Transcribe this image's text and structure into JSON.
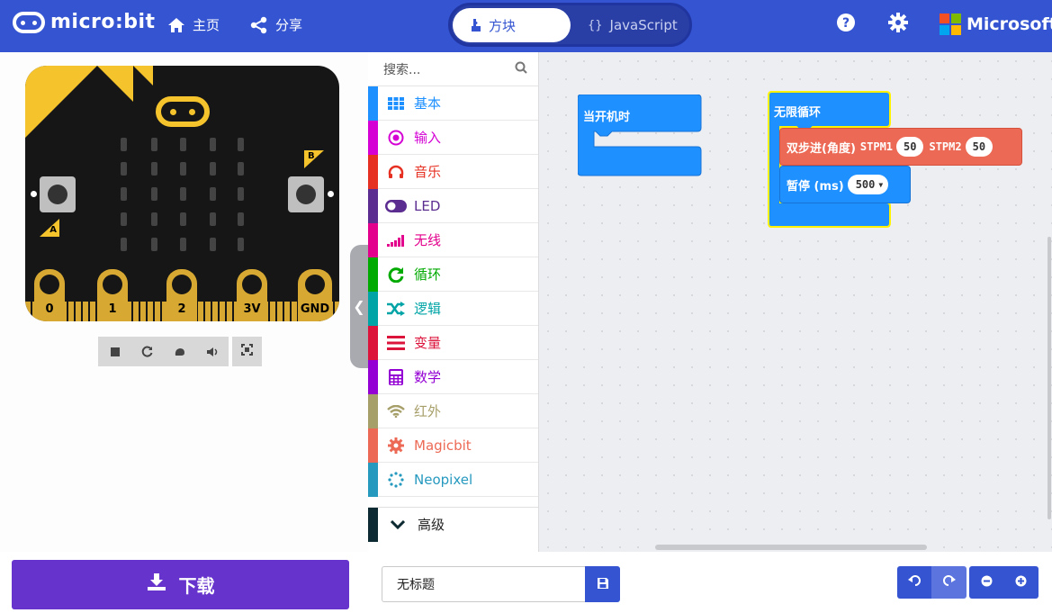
{
  "header": {
    "brand": "micro:bit",
    "home_label": "主页",
    "share_label": "分享",
    "blocks_tab": "方块",
    "js_tab": "JavaScript",
    "js_tab_icon": "{}",
    "microsoft_label": "Microsoft"
  },
  "simulator": {
    "button_a": "A",
    "button_b": "B",
    "pins": [
      "0",
      "1",
      "2",
      "3V",
      "GND"
    ]
  },
  "toolbox": {
    "search_placeholder": "搜索...",
    "categories": [
      {
        "label": "基本",
        "color": "#1e90ff",
        "icon": "grid-icon"
      },
      {
        "label": "输入",
        "color": "#d400d4",
        "icon": "target-icon"
      },
      {
        "label": "音乐",
        "color": "#e63022",
        "icon": "headphones-icon"
      },
      {
        "label": "LED",
        "color": "#5c2d91",
        "icon": "toggle-icon"
      },
      {
        "label": "无线",
        "color": "#e3008c",
        "icon": "signal-icon"
      },
      {
        "label": "循环",
        "color": "#00aa00",
        "icon": "refresh-icon"
      },
      {
        "label": "逻辑",
        "color": "#00a4a6",
        "icon": "shuffle-icon"
      },
      {
        "label": "变量",
        "color": "#dc143c",
        "icon": "list-icon"
      },
      {
        "label": "数学",
        "color": "#9400d3",
        "icon": "calculator-icon"
      },
      {
        "label": "红外",
        "color": "#a79f6a",
        "icon": "wifi-icon"
      },
      {
        "label": "Magicbit",
        "color": "#ec6a55",
        "icon": "gear-icon"
      },
      {
        "label": "Neopixel",
        "color": "#2699bf",
        "icon": "dots-circle-icon"
      }
    ],
    "advanced_label": "高级",
    "advanced_color": "#0d2a32"
  },
  "workspace": {
    "on_start": "当开机时",
    "forever": "无限循环",
    "stepper_block": "双步进(角度)",
    "stpm1_label": "STPM1",
    "stpm1_value": "50",
    "stpm2_label": "STPM2",
    "stpm2_value": "50",
    "pause_label": "暂停 (ms)",
    "pause_value": "500",
    "colors": {
      "basic": "#1e90ff",
      "loops": "#1e90ff",
      "magicbit": "#ec6a55",
      "highlight": "#fff200"
    }
  },
  "bottom": {
    "download_label": "下载",
    "project_name": "无标题"
  },
  "colors": {
    "header": "#3454d1",
    "download": "#6633cc"
  }
}
